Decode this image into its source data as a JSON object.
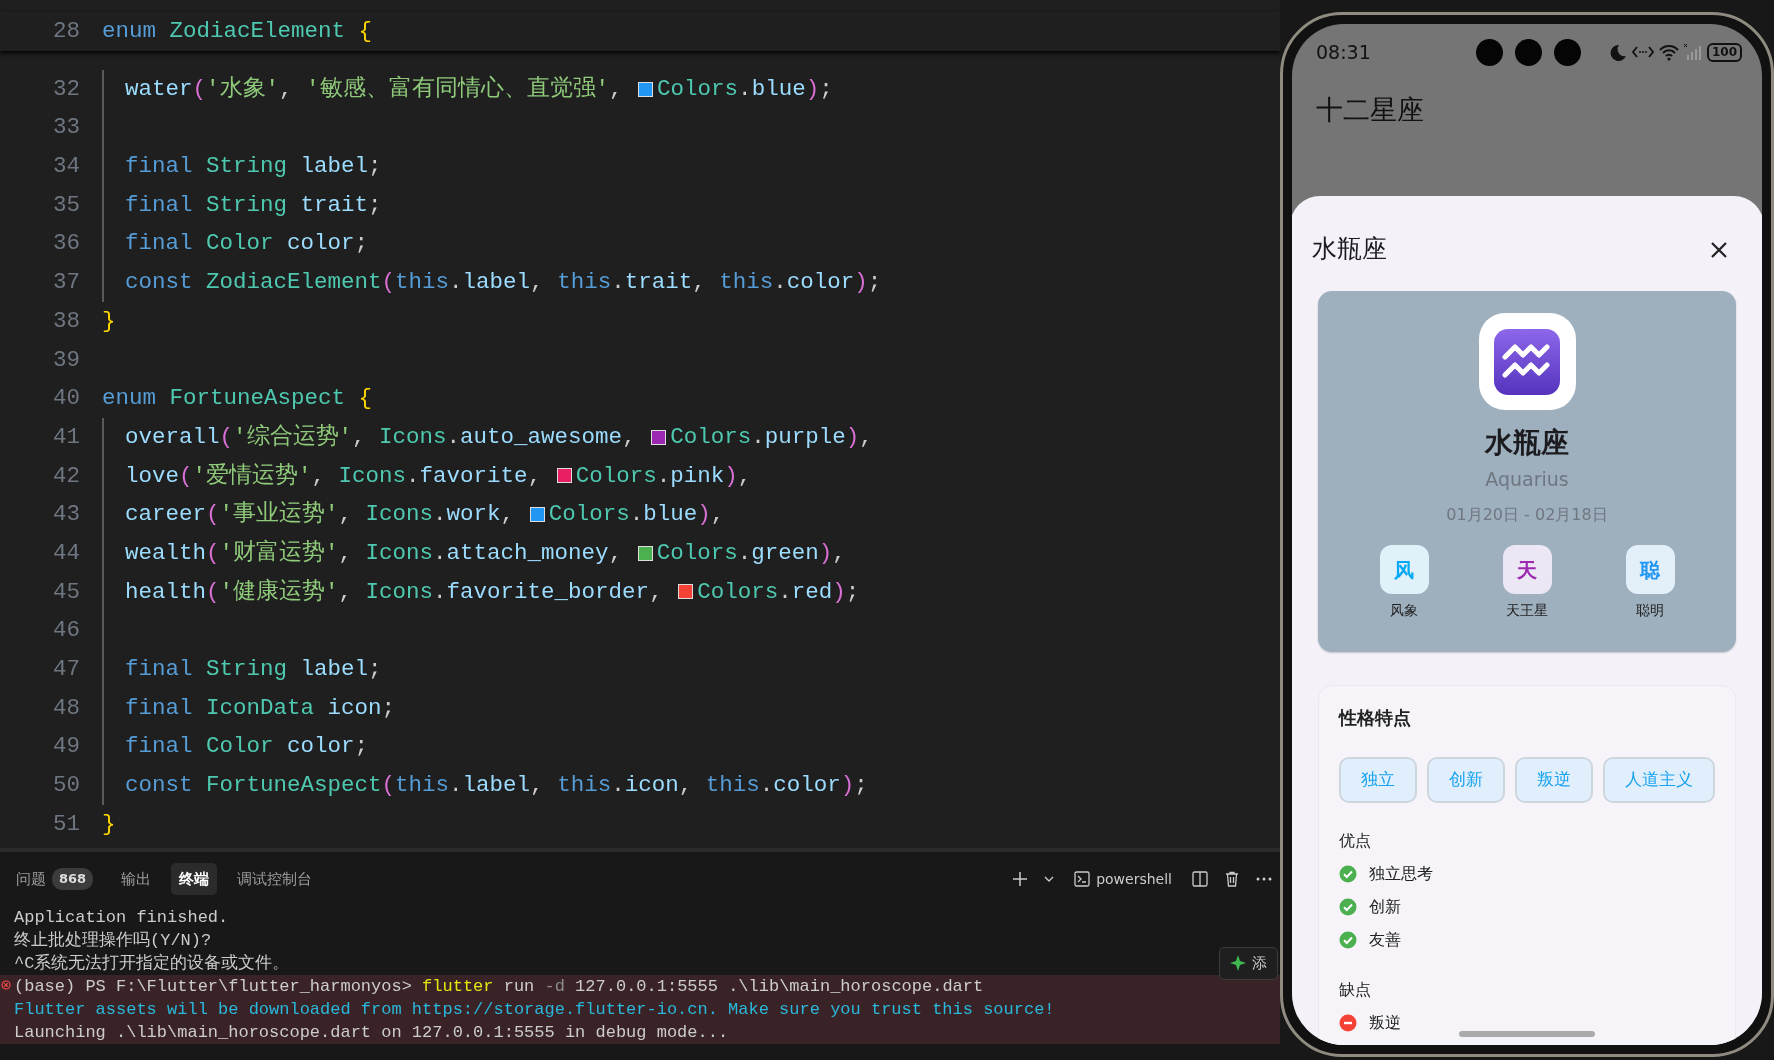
{
  "editor": {
    "sticky_line": {
      "number": "28",
      "indented": false,
      "tokens": [
        {
          "kind": "keyword",
          "text": "enum "
        },
        {
          "kind": "type",
          "text": "ZodiacElement "
        },
        {
          "kind": "bracket1",
          "text": "{"
        }
      ]
    },
    "lines": [
      {
        "number": "32",
        "indented": true,
        "tokens": [
          {
            "kind": "member",
            "text": "water"
          },
          {
            "kind": "bracket2",
            "text": "("
          },
          {
            "kind": "string",
            "text": "'水象'"
          },
          {
            "kind": "punct",
            "text": ", "
          },
          {
            "kind": "string",
            "text": "'敏感、富有同情心、直觉强'"
          },
          {
            "kind": "punct",
            "text": ", "
          },
          {
            "kind": "swatch",
            "color": "#2196f3"
          },
          {
            "kind": "type",
            "text": "Colors"
          },
          {
            "kind": "punct",
            "text": "."
          },
          {
            "kind": "member",
            "text": "blue"
          },
          {
            "kind": "bracket2",
            "text": ")"
          },
          {
            "kind": "punct",
            "text": ";"
          }
        ]
      },
      {
        "number": "33",
        "indented": true
      },
      {
        "number": "34",
        "indented": true,
        "tokens": [
          {
            "kind": "keyword",
            "text": "final "
          },
          {
            "kind": "type",
            "text": "String "
          },
          {
            "kind": "member",
            "text": "label"
          },
          {
            "kind": "punct",
            "text": ";"
          }
        ]
      },
      {
        "number": "35",
        "indented": true,
        "tokens": [
          {
            "kind": "keyword",
            "text": "final "
          },
          {
            "kind": "type",
            "text": "String "
          },
          {
            "kind": "member",
            "text": "trait"
          },
          {
            "kind": "punct",
            "text": ";"
          }
        ]
      },
      {
        "number": "36",
        "indented": true,
        "tokens": [
          {
            "kind": "keyword",
            "text": "final "
          },
          {
            "kind": "type",
            "text": "Color "
          },
          {
            "kind": "member",
            "text": "color"
          },
          {
            "kind": "punct",
            "text": ";"
          }
        ]
      },
      {
        "number": "37",
        "indented": true,
        "tokens": [
          {
            "kind": "keyword",
            "text": "const "
          },
          {
            "kind": "type",
            "text": "ZodiacElement"
          },
          {
            "kind": "bracket2",
            "text": "("
          },
          {
            "kind": "keyword",
            "text": "this"
          },
          {
            "kind": "punct",
            "text": "."
          },
          {
            "kind": "member",
            "text": "label"
          },
          {
            "kind": "punct",
            "text": ", "
          },
          {
            "kind": "keyword",
            "text": "this"
          },
          {
            "kind": "punct",
            "text": "."
          },
          {
            "kind": "member",
            "text": "trait"
          },
          {
            "kind": "punct",
            "text": ", "
          },
          {
            "kind": "keyword",
            "text": "this"
          },
          {
            "kind": "punct",
            "text": "."
          },
          {
            "kind": "member",
            "text": "color"
          },
          {
            "kind": "bracket2",
            "text": ")"
          },
          {
            "kind": "punct",
            "text": ";"
          }
        ]
      },
      {
        "number": "38",
        "indented": false,
        "tokens": [
          {
            "kind": "bracket1",
            "text": "}"
          }
        ]
      },
      {
        "number": "39",
        "indented": false
      },
      {
        "number": "40",
        "indented": false,
        "tokens": [
          {
            "kind": "keyword",
            "text": "enum "
          },
          {
            "kind": "type",
            "text": "FortuneAspect "
          },
          {
            "kind": "bracket1",
            "text": "{"
          }
        ]
      },
      {
        "number": "41",
        "indented": true,
        "tokens": [
          {
            "kind": "member",
            "text": "overall"
          },
          {
            "kind": "bracket2",
            "text": "("
          },
          {
            "kind": "string",
            "text": "'综合运势'"
          },
          {
            "kind": "punct",
            "text": ", "
          },
          {
            "kind": "type",
            "text": "Icons"
          },
          {
            "kind": "punct",
            "text": "."
          },
          {
            "kind": "member",
            "text": "auto_awesome"
          },
          {
            "kind": "punct",
            "text": ", "
          },
          {
            "kind": "swatch",
            "color": "#9c27b0"
          },
          {
            "kind": "type",
            "text": "Colors"
          },
          {
            "kind": "punct",
            "text": "."
          },
          {
            "kind": "member",
            "text": "purple"
          },
          {
            "kind": "bracket2",
            "text": ")"
          },
          {
            "kind": "punct",
            "text": ","
          }
        ]
      },
      {
        "number": "42",
        "indented": true,
        "tokens": [
          {
            "kind": "member",
            "text": "love"
          },
          {
            "kind": "bracket2",
            "text": "("
          },
          {
            "kind": "string",
            "text": "'爱情运势'"
          },
          {
            "kind": "punct",
            "text": ", "
          },
          {
            "kind": "type",
            "text": "Icons"
          },
          {
            "kind": "punct",
            "text": "."
          },
          {
            "kind": "member",
            "text": "favorite"
          },
          {
            "kind": "punct",
            "text": ", "
          },
          {
            "kind": "swatch",
            "color": "#e91e63"
          },
          {
            "kind": "type",
            "text": "Colors"
          },
          {
            "kind": "punct",
            "text": "."
          },
          {
            "kind": "member",
            "text": "pink"
          },
          {
            "kind": "bracket2",
            "text": ")"
          },
          {
            "kind": "punct",
            "text": ","
          }
        ]
      },
      {
        "number": "43",
        "indented": true,
        "tokens": [
          {
            "kind": "member",
            "text": "career"
          },
          {
            "kind": "bracket2",
            "text": "("
          },
          {
            "kind": "string",
            "text": "'事业运势'"
          },
          {
            "kind": "punct",
            "text": ", "
          },
          {
            "kind": "type",
            "text": "Icons"
          },
          {
            "kind": "punct",
            "text": "."
          },
          {
            "kind": "member",
            "text": "work"
          },
          {
            "kind": "punct",
            "text": ", "
          },
          {
            "kind": "swatch",
            "color": "#2196f3"
          },
          {
            "kind": "type",
            "text": "Colors"
          },
          {
            "kind": "punct",
            "text": "."
          },
          {
            "kind": "member",
            "text": "blue"
          },
          {
            "kind": "bracket2",
            "text": ")"
          },
          {
            "kind": "punct",
            "text": ","
          }
        ]
      },
      {
        "number": "44",
        "indented": true,
        "tokens": [
          {
            "kind": "member",
            "text": "wealth"
          },
          {
            "kind": "bracket2",
            "text": "("
          },
          {
            "kind": "string",
            "text": "'财富运势'"
          },
          {
            "kind": "punct",
            "text": ", "
          },
          {
            "kind": "type",
            "text": "Icons"
          },
          {
            "kind": "punct",
            "text": "."
          },
          {
            "kind": "member",
            "text": "attach_money"
          },
          {
            "kind": "punct",
            "text": ", "
          },
          {
            "kind": "swatch",
            "color": "#4caf50"
          },
          {
            "kind": "type",
            "text": "Colors"
          },
          {
            "kind": "punct",
            "text": "."
          },
          {
            "kind": "member",
            "text": "green"
          },
          {
            "kind": "bracket2",
            "text": ")"
          },
          {
            "kind": "punct",
            "text": ","
          }
        ]
      },
      {
        "number": "45",
        "indented": true,
        "tokens": [
          {
            "kind": "member",
            "text": "health"
          },
          {
            "kind": "bracket2",
            "text": "("
          },
          {
            "kind": "string",
            "text": "'健康运势'"
          },
          {
            "kind": "punct",
            "text": ", "
          },
          {
            "kind": "type",
            "text": "Icons"
          },
          {
            "kind": "punct",
            "text": "."
          },
          {
            "kind": "member",
            "text": "favorite_border"
          },
          {
            "kind": "punct",
            "text": ", "
          },
          {
            "kind": "swatch",
            "color": "#f44336"
          },
          {
            "kind": "type",
            "text": "Colors"
          },
          {
            "kind": "punct",
            "text": "."
          },
          {
            "kind": "member",
            "text": "red"
          },
          {
            "kind": "bracket2",
            "text": ")"
          },
          {
            "kind": "punct",
            "text": ";"
          }
        ]
      },
      {
        "number": "46",
        "indented": true
      },
      {
        "number": "47",
        "indented": true,
        "tokens": [
          {
            "kind": "keyword",
            "text": "final "
          },
          {
            "kind": "type",
            "text": "String "
          },
          {
            "kind": "member",
            "text": "label"
          },
          {
            "kind": "punct",
            "text": ";"
          }
        ]
      },
      {
        "number": "48",
        "indented": true,
        "tokens": [
          {
            "kind": "keyword",
            "text": "final "
          },
          {
            "kind": "type",
            "text": "IconData "
          },
          {
            "kind": "member",
            "text": "icon"
          },
          {
            "kind": "punct",
            "text": ";"
          }
        ]
      },
      {
        "number": "49",
        "indented": true,
        "tokens": [
          {
            "kind": "keyword",
            "text": "final "
          },
          {
            "kind": "type",
            "text": "Color "
          },
          {
            "kind": "member",
            "text": "color"
          },
          {
            "kind": "punct",
            "text": ";"
          }
        ]
      },
      {
        "number": "50",
        "indented": true,
        "tokens": [
          {
            "kind": "keyword",
            "text": "const "
          },
          {
            "kind": "type",
            "text": "FortuneAspect"
          },
          {
            "kind": "bracket2",
            "text": "("
          },
          {
            "kind": "keyword",
            "text": "this"
          },
          {
            "kind": "punct",
            "text": "."
          },
          {
            "kind": "member",
            "text": "label"
          },
          {
            "kind": "punct",
            "text": ", "
          },
          {
            "kind": "keyword",
            "text": "this"
          },
          {
            "kind": "punct",
            "text": "."
          },
          {
            "kind": "member",
            "text": "icon"
          },
          {
            "kind": "punct",
            "text": ", "
          },
          {
            "kind": "keyword",
            "text": "this"
          },
          {
            "kind": "punct",
            "text": "."
          },
          {
            "kind": "member",
            "text": "color"
          },
          {
            "kind": "bracket2",
            "text": ")"
          },
          {
            "kind": "punct",
            "text": ";"
          }
        ]
      },
      {
        "number": "51",
        "indented": false,
        "tokens": [
          {
            "kind": "bracket1",
            "text": "}"
          }
        ]
      }
    ]
  },
  "panel": {
    "tabs": [
      {
        "label": "问题",
        "badge": "868",
        "selected": false
      },
      {
        "label": "输出",
        "selected": false
      },
      {
        "label": "终端",
        "selected": true
      },
      {
        "label": "调试控制台",
        "selected": false
      }
    ],
    "shell_name": "powershell",
    "terminal": [
      {
        "highlighted": false,
        "error_mark": false,
        "segments": [
          {
            "kind": "plain",
            "text": "Application finished."
          }
        ]
      },
      {
        "highlighted": false,
        "error_mark": false,
        "segments": [
          {
            "kind": "plain",
            "text": "终止批处理操作吗(Y/N)?"
          }
        ]
      },
      {
        "highlighted": false,
        "error_mark": false,
        "segments": [
          {
            "kind": "plain",
            "text": "^C系统无法打开指定的设备或文件。"
          }
        ]
      },
      {
        "highlighted": true,
        "error_mark": true,
        "segments": [
          {
            "kind": "plain",
            "text": "(base) PS F:\\Flutter\\flutter_harmonyos> "
          },
          {
            "kind": "command",
            "text": "flutter"
          },
          {
            "kind": "plain",
            "text": " run "
          },
          {
            "kind": "flag",
            "text": "-d"
          },
          {
            "kind": "plain",
            "text": " 127.0.0.1:5555 .\\lib\\main_horoscope.dart"
          }
        ]
      },
      {
        "highlighted": true,
        "error_mark": false,
        "segments": [
          {
            "kind": "info",
            "text": "Flutter assets will be downloaded from https://storage.flutter-io.cn. Make sure you trust this source!"
          }
        ]
      },
      {
        "highlighted": true,
        "error_mark": false,
        "segments": [
          {
            "kind": "plain",
            "text": "Launching .\\lib\\main_horoscope.dart on 127.0.0.1:5555 in debug mode..."
          }
        ]
      }
    ],
    "side_button": "添"
  },
  "phone": {
    "status_bar": {
      "time": "08:31",
      "battery": "100"
    },
    "app_title": "十二星座",
    "sheet": {
      "title": "水瓶座",
      "hero": {
        "name": "水瓶座",
        "latin": "Aquarius",
        "dates": "01月20日 - 02月18日",
        "attributes": [
          {
            "glyph": "风",
            "label": "风象",
            "color": "#03a9f4"
          },
          {
            "glyph": "天",
            "label": "天王星",
            "color": "#9c27b0"
          },
          {
            "glyph": "聪",
            "label": "聪明",
            "color": "#2196f3"
          }
        ]
      },
      "traits": {
        "title": "性格特点",
        "tags": [
          "独立",
          "创新",
          "叛逆",
          "人道主义"
        ],
        "sections": [
          {
            "kind": "pros",
            "title": "优点",
            "items": [
              "独立思考",
              "创新",
              "友善"
            ]
          },
          {
            "kind": "cons",
            "title": "缺点",
            "items": [
              "叛逆"
            ]
          }
        ]
      }
    }
  }
}
